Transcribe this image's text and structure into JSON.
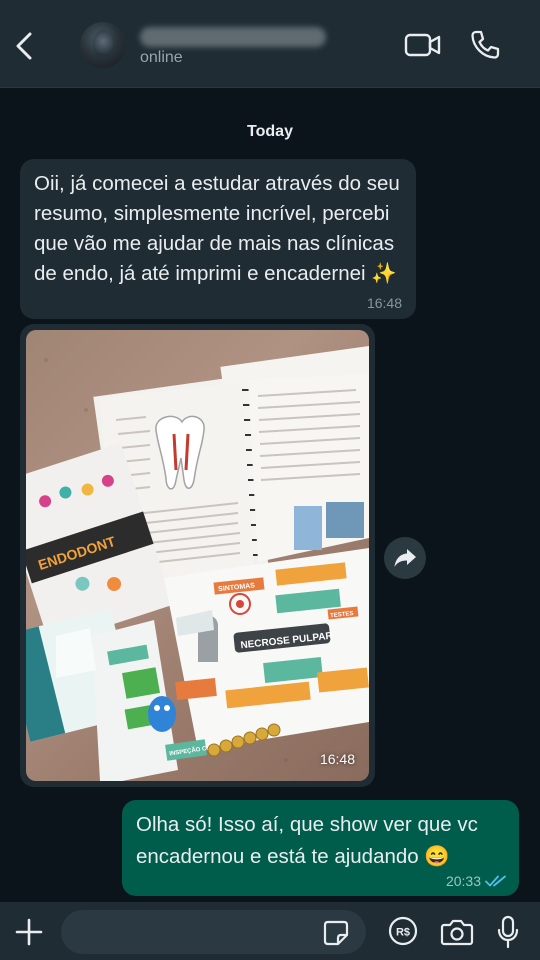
{
  "header": {
    "status": "online",
    "icons": {
      "back": "chevron-left-icon",
      "video": "video-camera-icon",
      "call": "phone-icon"
    }
  },
  "date_separator": "Today",
  "messages": [
    {
      "direction": "incoming",
      "text": "Oii, já comecei a estudar através do seu resumo, simplesmente incrível, percebi que vão me ajudar de mais nas clínicas de endo, já até imprimi e encadernei ✨",
      "time": "16:48"
    },
    {
      "direction": "incoming",
      "type": "photo",
      "time": "16:48",
      "photo_labels": {
        "card_title": "ENDODONT",
        "necrose": "NECROSE PULPAR",
        "inspecao": "INSPEÇÃO CLÍNICA",
        "sintomas": "SINTOMAS",
        "testes": "TESTES"
      }
    },
    {
      "direction": "outgoing",
      "text": "Olha só! Isso aí, que show ver que vc encadernou e está te ajudando 😄",
      "time": "20:33",
      "status": "read"
    }
  ],
  "input": {
    "placeholder": ""
  },
  "colors": {
    "background": "#0b141a",
    "header": "#1f2c33",
    "incoming_bubble": "#1f2c33",
    "outgoing_bubble": "#005c4b",
    "read_ticks": "#53bdeb"
  }
}
